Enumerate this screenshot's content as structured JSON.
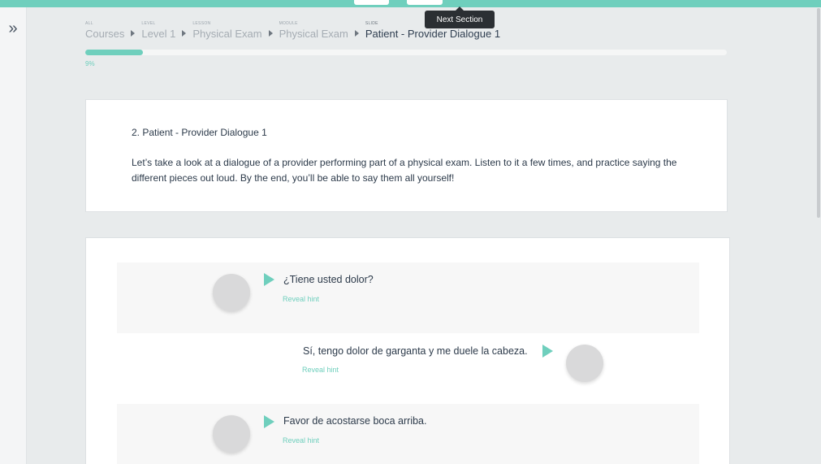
{
  "tooltip": {
    "text": "Next Section"
  },
  "breadcrumb": [
    {
      "level": "ALL",
      "name": "Courses"
    },
    {
      "level": "LEVEL",
      "name": "Level 1"
    },
    {
      "level": "LESSON",
      "name": "Physical Exam"
    },
    {
      "level": "MODULE",
      "name": "Physical Exam"
    },
    {
      "level": "SLIDE",
      "name": "Patient - Provider Dialogue 1"
    }
  ],
  "progress": {
    "label": "9%",
    "value": 0.09
  },
  "intro": {
    "title": "2. Patient - Provider Dialogue 1",
    "body": "Let’s take a look at a dialogue of a provider performing part of a physical exam. Listen to it a few times, and practice saying the different pieces out loud. By the end, you’ll be able to say them all yourself!"
  },
  "dialogue": [
    {
      "text": "¿Tiene usted dolor?",
      "hint": "Reveal hint"
    },
    {
      "text": "Sí, tengo dolor de garganta y me duele la cabeza.",
      "hint": "Reveal hint"
    },
    {
      "text": "Favor de acostarse boca arriba.",
      "hint": "Reveal hint"
    }
  ],
  "colors": {
    "accent": "#6fcfbd",
    "text": "#2c3a4a",
    "tooltip_bg": "#2b2f33"
  }
}
